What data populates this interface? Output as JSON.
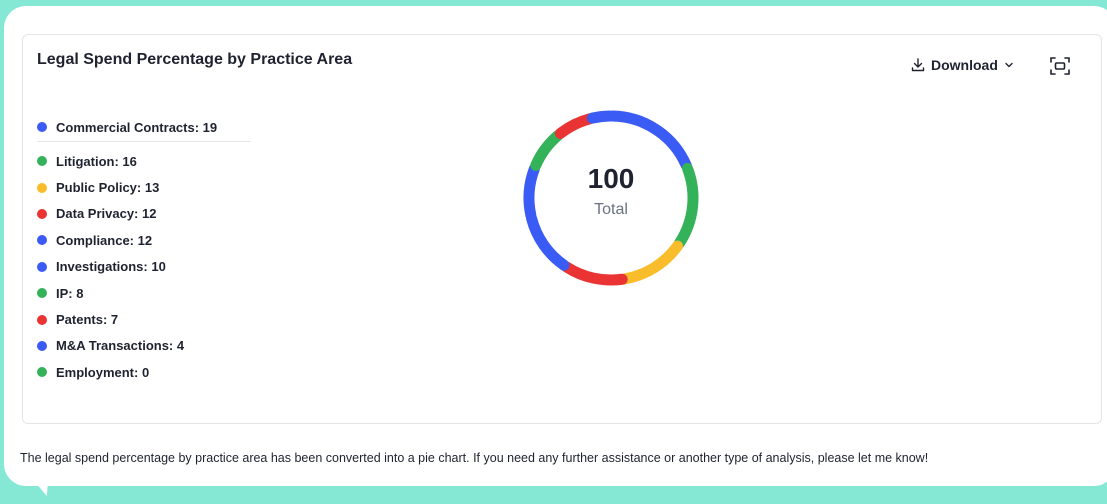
{
  "chart_data": {
    "type": "pie",
    "title": "Legal Spend Percentage by Practice Area",
    "categories": [
      "Commercial Contracts",
      "Litigation",
      "Public Policy",
      "Data Privacy",
      "Compliance",
      "Investigations",
      "IP",
      "Patents",
      "M&A Transactions",
      "Employment"
    ],
    "values": [
      19,
      16,
      13,
      12,
      12,
      10,
      8,
      7,
      4,
      0
    ],
    "colors": [
      "#3b5bf5",
      "#34b25a",
      "#f9bd2b",
      "#ea3333",
      "#3b5bf5",
      "#3b5bf5",
      "#34b25a",
      "#ea3333",
      "#3b5bf5",
      "#34b25a"
    ],
    "center_value": "100",
    "center_label": "Total",
    "legend_labels": [
      "Commercial Contracts: 19",
      "Litigation: 16",
      "Public Policy: 13",
      "Data Privacy: 12",
      "Compliance: 12",
      "Investigations: 10",
      "IP: 8",
      "Patents: 7",
      "M&A Transactions: 4",
      "Employment: 0"
    ],
    "legend_placement": "left",
    "donut": true
  },
  "toolbar": {
    "download_label": "Download",
    "download_icon": "download-icon",
    "dropdown_icon": "chevron-down-icon",
    "expand_icon": "expand-icon"
  },
  "message": {
    "text": "The legal spend percentage by practice area has been converted into a pie chart. If you need any further assistance or another type of analysis, please let me know!"
  },
  "colors": {
    "background": "#84e8d4",
    "blue": "#3b5bf5",
    "green": "#34b25a",
    "yellow": "#f9bd2b",
    "red": "#ea3333"
  }
}
